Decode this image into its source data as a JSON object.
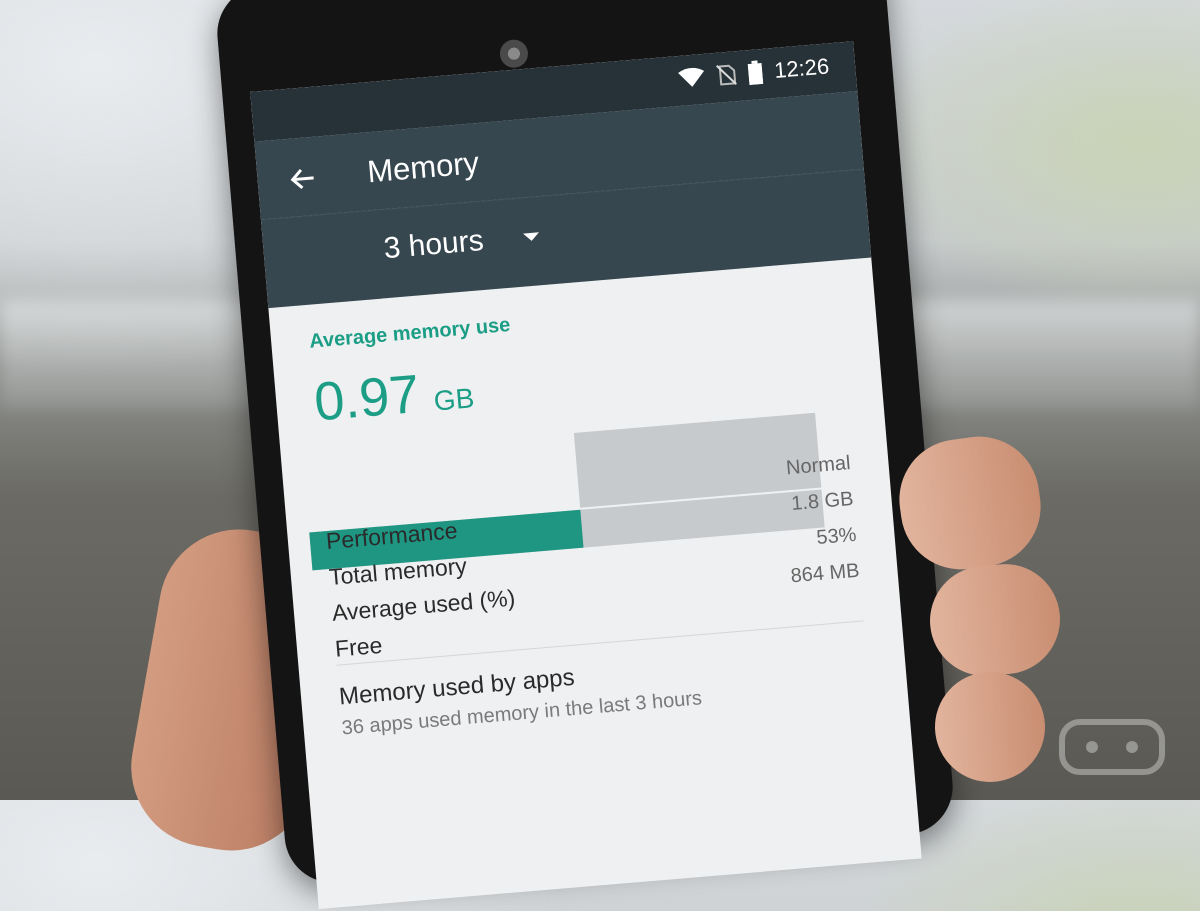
{
  "status_bar": {
    "time": "12:26",
    "icons": [
      "wifi-icon",
      "no-sim-icon",
      "battery-icon"
    ]
  },
  "app_bar": {
    "title": "Memory",
    "back_icon": "arrow-left-icon"
  },
  "spinner": {
    "selected": "3 hours"
  },
  "average": {
    "label": "Average memory use",
    "value": "0.97",
    "unit": "GB",
    "usage_fraction": 0.53
  },
  "stats": {
    "rows": [
      {
        "label": "Performance",
        "value": "Normal"
      },
      {
        "label": "Total memory",
        "value": "1.8 GB"
      },
      {
        "label": "Average used (%)",
        "value": "53%"
      },
      {
        "label": "Free",
        "value": "864 MB"
      }
    ]
  },
  "apps": {
    "title": "Memory used by apps",
    "subtitle": "36 apps used memory in the last 3 hours"
  },
  "colors": {
    "accent": "#1c9e86",
    "toolbar": "#37474f",
    "statusbar": "#263238"
  }
}
